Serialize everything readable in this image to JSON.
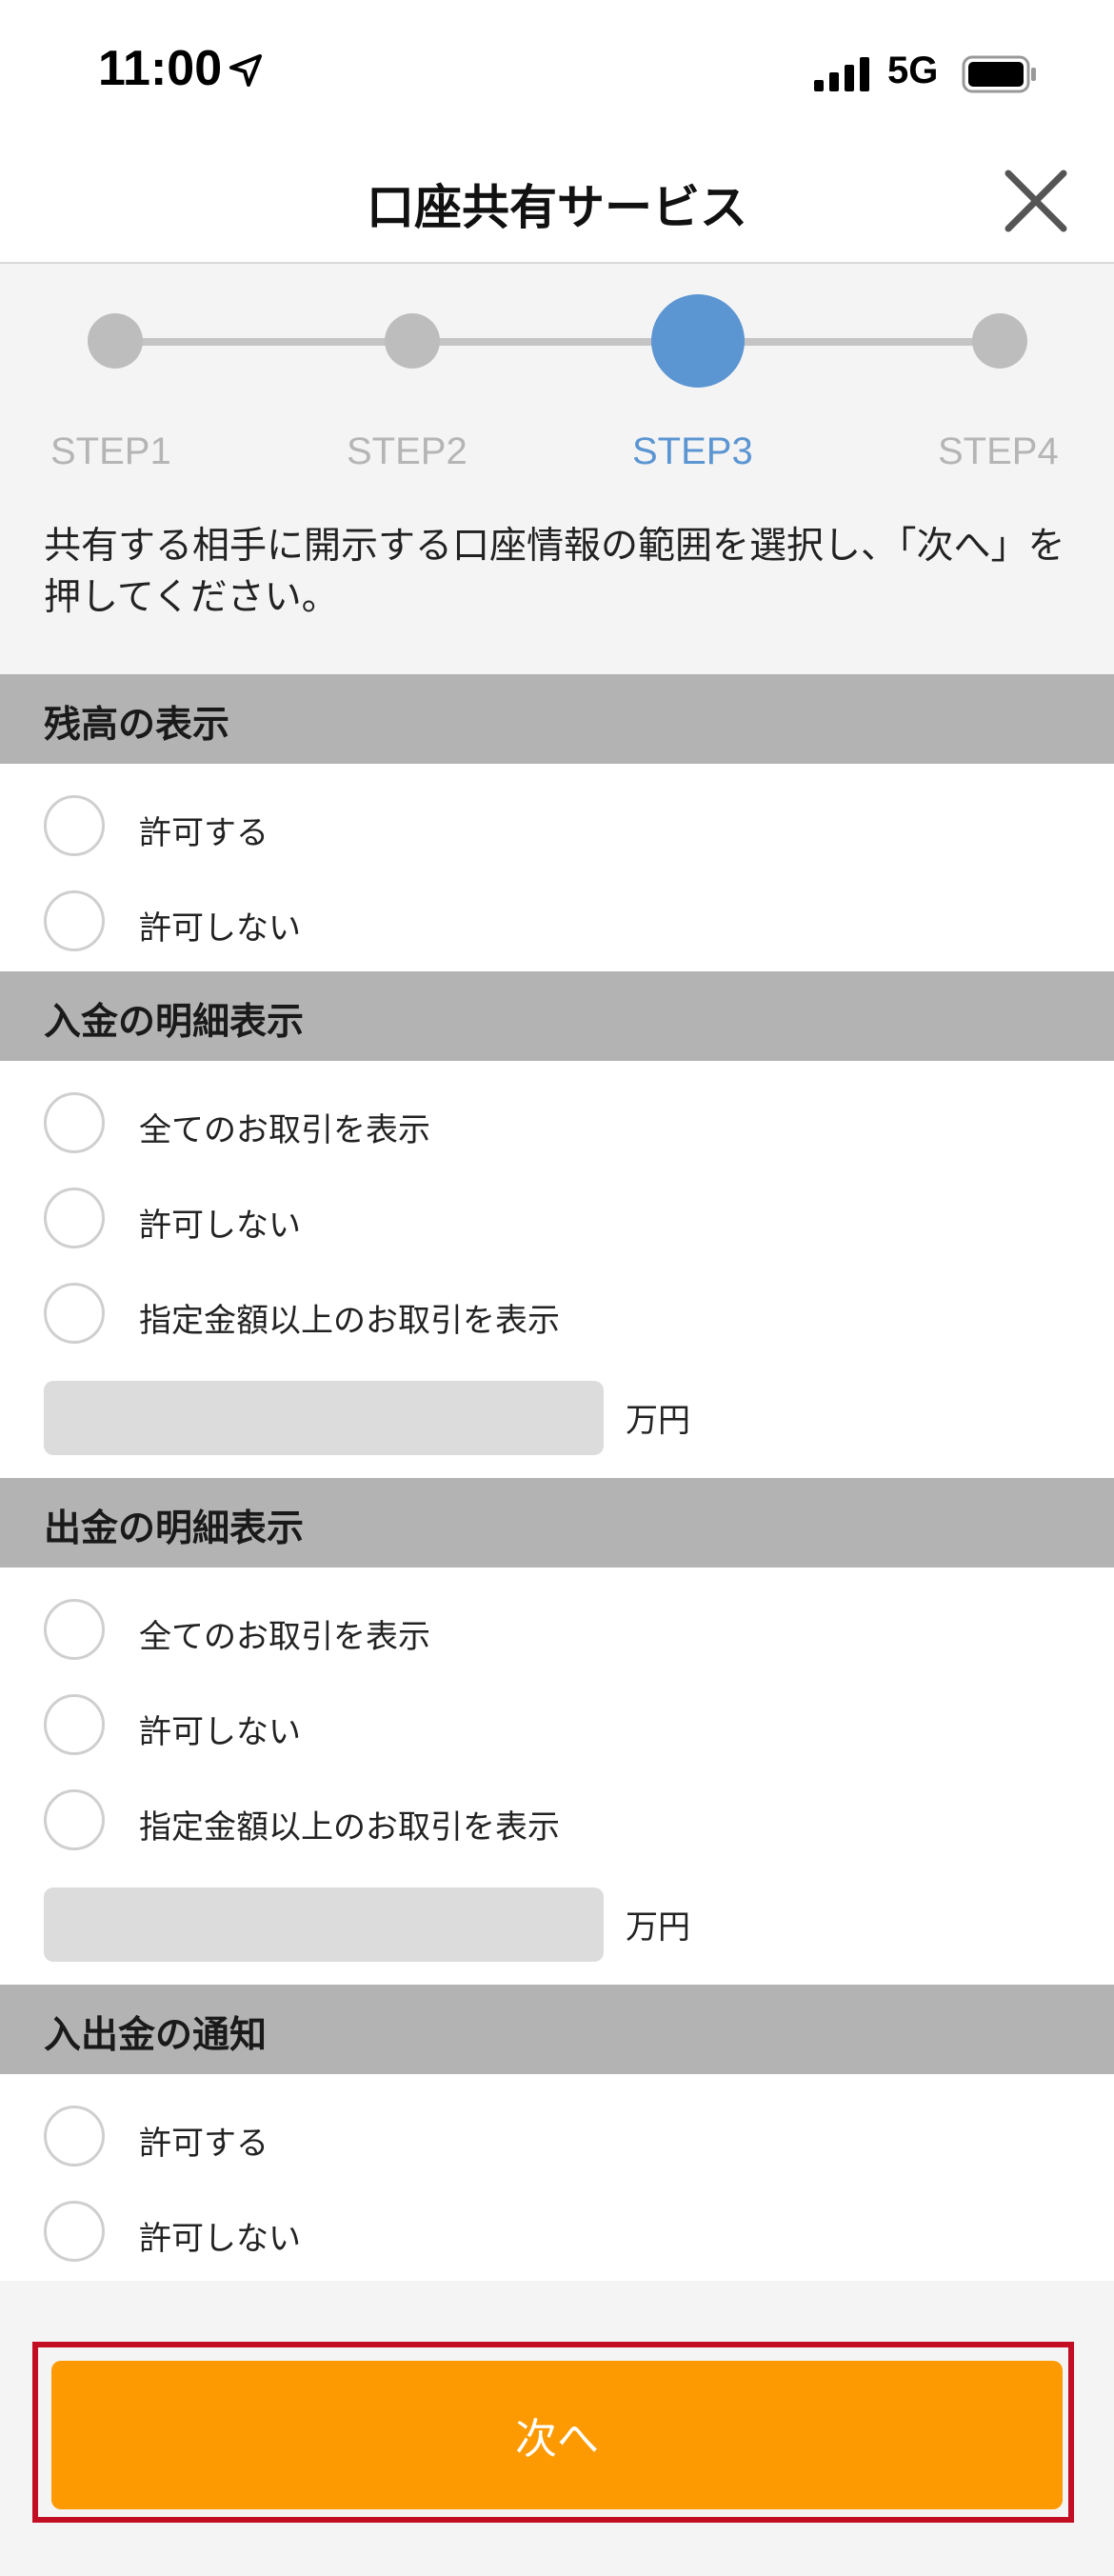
{
  "status_bar": {
    "time": "11:00",
    "network": "5G",
    "icons": [
      "location-arrow-icon",
      "signal-icon",
      "battery-icon"
    ]
  },
  "header": {
    "title": "口座共有サービス",
    "close_icon": "close-icon"
  },
  "stepper": {
    "steps": [
      {
        "label": "STEP1",
        "active": false
      },
      {
        "label": "STEP2",
        "active": false
      },
      {
        "label": "STEP3",
        "active": true
      },
      {
        "label": "STEP4",
        "active": false
      }
    ],
    "active_color": "#5b95d2",
    "inactive_color": "#bdbdbd"
  },
  "instruction": "共有する相手に開示する口座情報の範囲を選択し、「次へ」を押してください。",
  "sections": [
    {
      "title": "残高の表示",
      "options": [
        "許可する",
        "許可しない"
      ]
    },
    {
      "title": "入金の明細表示",
      "options": [
        "全てのお取引を表示",
        "許可しない",
        "指定金額以上のお取引を表示"
      ],
      "amount": {
        "value": "",
        "unit": "万円"
      }
    },
    {
      "title": "出金の明細表示",
      "options": [
        "全てのお取引を表示",
        "許可しない",
        "指定金額以上のお取引を表示"
      ],
      "amount": {
        "value": "",
        "unit": "万円"
      }
    },
    {
      "title": "入出金の通知",
      "options": [
        "許可する",
        "許可しない"
      ]
    }
  ],
  "footer": {
    "next_label": "次へ",
    "button_color": "#fd9a02",
    "highlight_color": "#c30d23"
  }
}
